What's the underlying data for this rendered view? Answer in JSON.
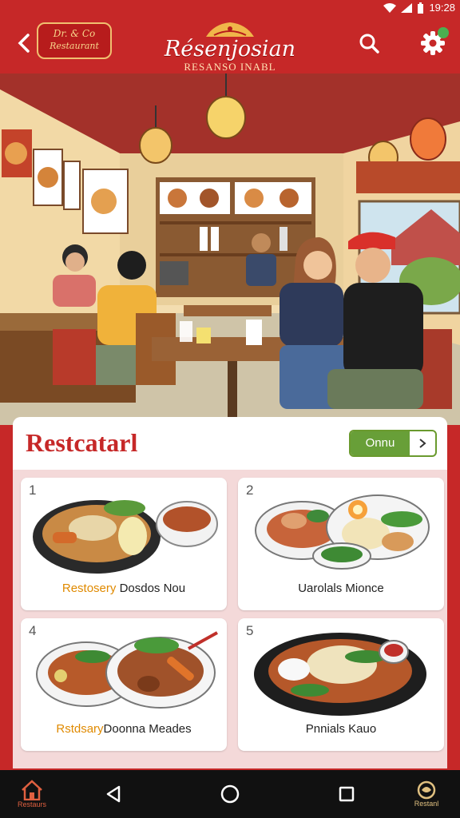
{
  "status_bar": {
    "time": "19:28"
  },
  "header": {
    "badge_line1": "Dr. & Co",
    "badge_line2": "Restaurant",
    "title": "Résenjosian",
    "subtitle": "RESANSO INABL"
  },
  "panel": {
    "title": "Restcatarl",
    "more_label": "Onnu"
  },
  "cards": [
    {
      "number": "1",
      "highlight": "Restosery",
      "label": " Dosdos Nou"
    },
    {
      "number": "2",
      "highlight": "",
      "label": "Uarolals Mionce"
    },
    {
      "number": "4",
      "highlight": "Rstdsary",
      "label": "Doonna Meades"
    },
    {
      "number": "5",
      "highlight": "",
      "label": "Pnnials Kauo"
    }
  ],
  "nav": {
    "home_label": "Restaurs",
    "brand_label": "Restanl"
  },
  "colors": {
    "primary": "#c62828",
    "accent": "#689f38",
    "panel": "#f4d9d9"
  }
}
